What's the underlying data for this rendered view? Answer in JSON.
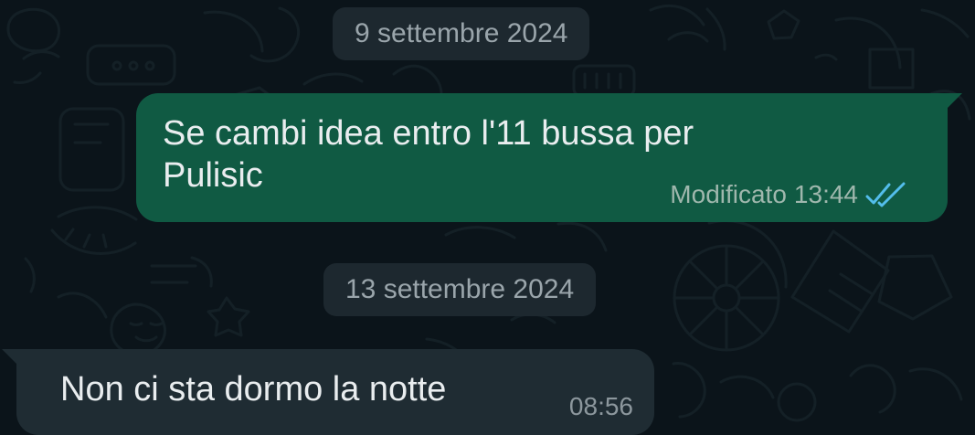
{
  "dates": {
    "first": "9 settembre 2024",
    "second": "13 settembre 2024"
  },
  "messages": [
    {
      "direction": "outgoing",
      "text": "Se cambi idea entro l'11 bussa per Pulisic",
      "edited_label": "Modificato",
      "time": "13:44",
      "status_icon": "double-check-read-icon"
    },
    {
      "direction": "incoming",
      "text": "Non ci sta dormo la notte",
      "time": "08:56"
    }
  ],
  "colors": {
    "background": "#0b141a",
    "outgoing_bubble": "#105a43",
    "incoming_bubble": "#1f2c33",
    "date_chip": "#1d282f",
    "read_ticks": "#53bdeb"
  }
}
